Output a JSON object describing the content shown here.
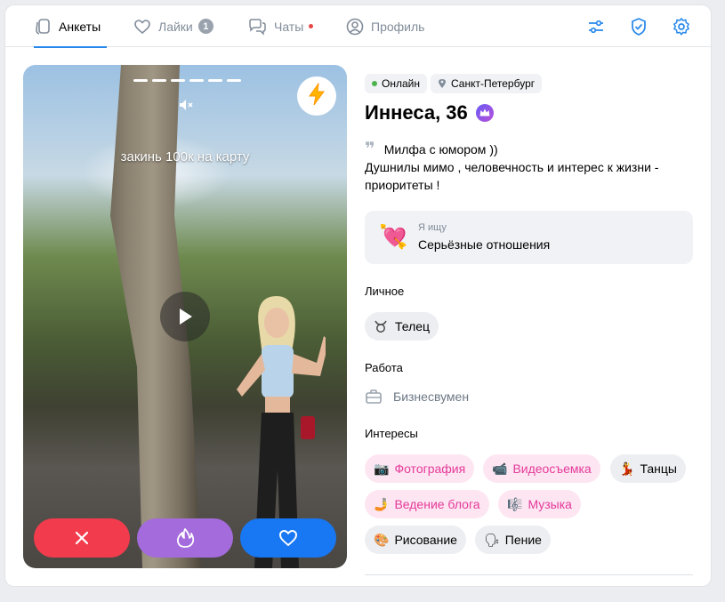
{
  "nav": {
    "tabs": [
      {
        "label": "Анкеты",
        "icon": "cards-icon",
        "active": true
      },
      {
        "label": "Лайки",
        "icon": "heart-icon",
        "badge": "1"
      },
      {
        "label": "Чаты",
        "icon": "chat-icon",
        "unread_dot": true
      },
      {
        "label": "Профиль",
        "icon": "profile-icon"
      }
    ],
    "actions": [
      "filters-icon",
      "shield-icon",
      "gear-icon"
    ]
  },
  "photo": {
    "caption": "закинь 100к на карту",
    "story_segments": 6,
    "actions": [
      "dislike-button",
      "superlike-button",
      "like-button"
    ]
  },
  "profile": {
    "status": "Онлайн",
    "city": "Санкт-Петербург",
    "name": "Иннеса, 36",
    "bio_line1": "Милфа с юмором ))",
    "bio_line2": "Душнилы мимо , человечность и интерес к жизни - приоритеты !",
    "looking_for_label": "Я ищу",
    "looking_for_value": "Серьёзные отношения",
    "personal_title": "Личное",
    "zodiac": "Телец",
    "work_title": "Работа",
    "work_value": "Бизнесвумен",
    "interests_title": "Интересы",
    "interests": [
      {
        "label": "Фотография",
        "emoji": "📷",
        "common": true
      },
      {
        "label": "Видеосъемка",
        "emoji": "📹",
        "common": true
      },
      {
        "label": "Танцы",
        "emoji": "💃",
        "common": false
      },
      {
        "label": "Ведение блога",
        "emoji": "🤳",
        "common": true
      },
      {
        "label": "Музыка",
        "emoji": "🎼",
        "common": true
      },
      {
        "label": "Рисование",
        "emoji": "🎨",
        "common": false
      },
      {
        "label": "Пение",
        "emoji": "🗣",
        "common": false
      }
    ]
  },
  "colors": {
    "accent": "#2688eb",
    "dislike": "#f23c4d",
    "superlike": "#a46bdc",
    "like": "#1877f2",
    "online": "#4bb34b",
    "interest_common": "#e4399a"
  }
}
